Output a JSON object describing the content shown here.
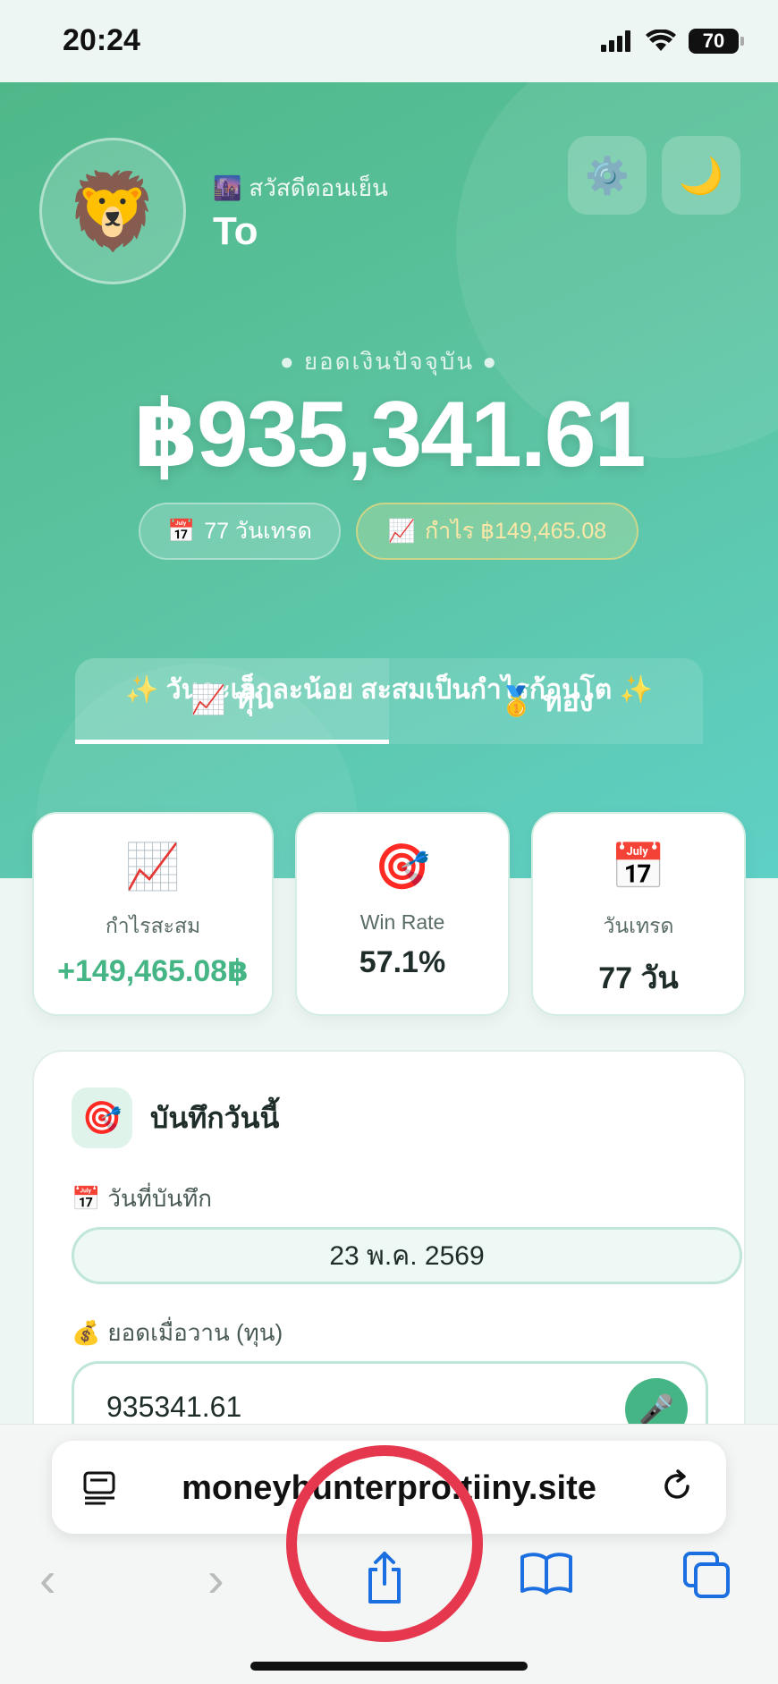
{
  "status": {
    "time": "20:24",
    "battery": "70"
  },
  "hero": {
    "avatar_emoji": "🦁",
    "greeting_emoji": "🌆",
    "greeting": "สวัสดีตอนเย็น",
    "username": "To",
    "settings_emoji": "⚙️",
    "theme_emoji": "🌙",
    "balance_label": "● ยอดเงินปัจจุบัน ●",
    "balance": "฿935,341.61",
    "days_pill": "77 วันเทรด",
    "days_pill_emoji": "📅",
    "profit_pill": "กำไร ฿149,465.08",
    "profit_pill_emoji": "📈",
    "motto": "✨ วันละเล็กละน้อย สะสมเป็นกำไรก้อนโต ✨"
  },
  "tabs": [
    {
      "emoji": "📈",
      "label": "หุ้น"
    },
    {
      "emoji": "🥇",
      "label": "ทอง"
    }
  ],
  "stats": {
    "profit": {
      "emoji": "📈",
      "label": "กำไรสะสม",
      "value": "+149,465.08฿"
    },
    "winrate": {
      "emoji": "🎯",
      "label": "Win Rate",
      "value": "57.1%"
    },
    "days": {
      "emoji": "📅",
      "label": "วันเทรด",
      "value": "77 วัน"
    }
  },
  "record": {
    "icon_emoji": "🎯",
    "title": "บันทึกวันนี้",
    "date_emoji": "📅",
    "date_label": "วันที่บันทึก",
    "date_value": "23 พ.ค. 2569",
    "amount_emoji": "💰",
    "amount_label": "ยอดเมื่อวาน (ทุน)",
    "amount_value": "935341.61",
    "mic_emoji": "🎤"
  },
  "browser": {
    "url": "moneyhunterpro.tiiny.site",
    "reader_icon": "reader-icon",
    "reload_icon": "reload-icon",
    "back_glyph": "‹",
    "forward_glyph": "›",
    "share_glyph": "⇪",
    "bookmarks_glyph": "📖",
    "tabs_glyph": "⧉"
  }
}
